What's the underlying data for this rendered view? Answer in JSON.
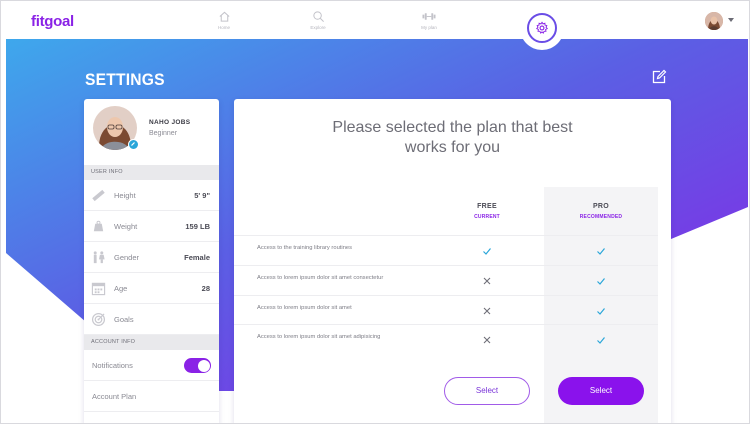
{
  "app": {
    "logo": "fitgoal"
  },
  "nav": {
    "items": [
      {
        "label": "Home",
        "icon": "home-icon"
      },
      {
        "label": "Explore",
        "icon": "search-icon"
      },
      {
        "label": "My plan",
        "icon": "dumbbell-icon"
      }
    ],
    "active_icon": "gear-icon"
  },
  "page": {
    "title": "SETTINGS",
    "edit_icon": "edit-icon"
  },
  "profile": {
    "name": "NAHO JOBS",
    "level": "Beginner"
  },
  "user_info": {
    "header": "USER INFO",
    "rows": [
      {
        "label": "Height",
        "value": "5' 9\"",
        "icon": "ruler-icon"
      },
      {
        "label": "Weight",
        "value": "159 LB",
        "icon": "weight-icon"
      },
      {
        "label": "Gender",
        "value": "Female",
        "icon": "gender-icon"
      },
      {
        "label": "Age",
        "value": "28",
        "icon": "calendar-icon"
      },
      {
        "label": "Goals",
        "value": "",
        "icon": "target-icon"
      }
    ]
  },
  "account_info": {
    "header": "ACCOUNT INFO",
    "notifications_label": "Notifications",
    "notifications_on": true,
    "plan_label": "Account Plan"
  },
  "plans": {
    "headline_line1": "Please selected the plan that best",
    "headline_line2": "works for you",
    "free": {
      "title": "FREE",
      "subtitle": "CURRENT",
      "button": "Select"
    },
    "pro": {
      "title": "PRO",
      "subtitle": "RECOMMENDED",
      "button": "Select"
    },
    "features": [
      {
        "text": "Access to the training library routines",
        "free": true,
        "pro": true
      },
      {
        "text": "Access to lorem ipsum dolor sit amet consectetur",
        "free": false,
        "pro": true
      },
      {
        "text": "Access to lorem ipsum dolor sit amet",
        "free": false,
        "pro": true
      },
      {
        "text": "Access to lorem ipsum dolor sit amet adipisicing",
        "free": false,
        "pro": true
      }
    ]
  },
  "colors": {
    "brand": "#8a22e6",
    "gradient_start": "#3fa6ea",
    "gradient_end": "#8a22e6",
    "check": "#2aa6d9"
  }
}
